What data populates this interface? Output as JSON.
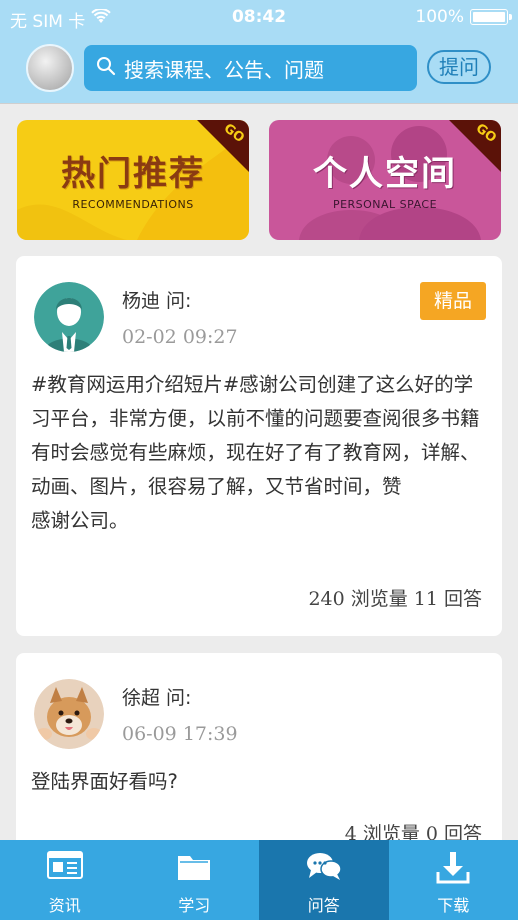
{
  "status_bar": {
    "carrier": "无 SIM 卡",
    "time": "08:42",
    "battery": "100%"
  },
  "search": {
    "placeholder": "搜索课程、公告、问题",
    "ask_label": "提问"
  },
  "banners": [
    {
      "title": "热门推荐",
      "subtitle": "RECOMMENDATIONS",
      "go": "GO",
      "color": "#f6cc15"
    },
    {
      "title": "个人空间",
      "subtitle": "PERSONAL SPACE",
      "go": "GO",
      "color": "#c9569a"
    }
  ],
  "questions": [
    {
      "asker": "杨迪 问:",
      "time": "02-02 09:27",
      "badge": "精品",
      "body": "#教育网运用介绍短片#感谢公司创建了这么好的学习平台，非常方便，以前不懂的问题要查阅很多书籍有时会感觉有些麻烦，现在好了有了教育网，详解、动画、图片，很容易了解，又节省时间，赞\n感谢公司。",
      "stats": "240 浏览量 11 回答"
    },
    {
      "asker": "徐超 问:",
      "time": "06-09 17:39",
      "body": "登陆界面好看吗?",
      "stats": "4 浏览量 0 回答"
    }
  ],
  "tabs": [
    {
      "label": "资讯",
      "icon": "news-icon"
    },
    {
      "label": "学习",
      "icon": "folder-icon"
    },
    {
      "label": "问答",
      "icon": "chat-icon",
      "active": true
    },
    {
      "label": "下载",
      "icon": "download-icon"
    }
  ],
  "colors": {
    "header_bg": "#a9dcf5",
    "accent": "#37a7e1",
    "tab_active": "#1a76ad",
    "badge": "#f5a623"
  }
}
